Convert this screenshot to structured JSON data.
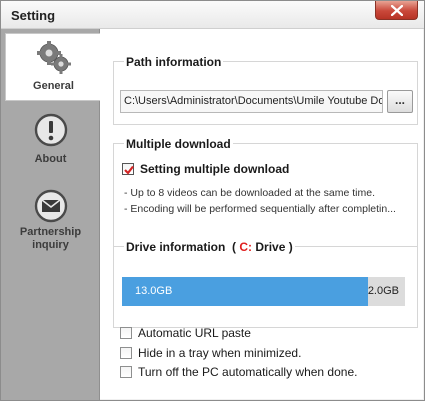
{
  "window": {
    "title": "Setting"
  },
  "sidebar": {
    "items": [
      {
        "label": "General",
        "icon": "gears-icon",
        "active": true
      },
      {
        "label": "About",
        "icon": "info-exclamation-icon",
        "active": false
      },
      {
        "label": "Partnership\ninquiry",
        "icon": "mail-icon",
        "active": false
      }
    ]
  },
  "path": {
    "title": "Path information",
    "value": "C:\\Users\\Administrator\\Documents\\Umile Youtube Do",
    "browse_label": "..."
  },
  "multiple": {
    "title": "Multiple download",
    "checkbox_label": "Setting multiple download",
    "checked": true,
    "notes": [
      "- Up to 8 videos can be downloaded at the same time.",
      "- Encoding will be performed sequentially after completin..."
    ]
  },
  "drive": {
    "title_prefix": "Drive information",
    "paren_open": "(",
    "drive_letter": "C:",
    "drive_word": "Drive",
    "paren_close": ")",
    "used_label": "13.0GB",
    "free_label": "2.0GB",
    "used_fraction": 0.87,
    "used_color": "#4a9fe0"
  },
  "options": [
    {
      "label": "Automatic URL paste",
      "checked": false
    },
    {
      "label": "Hide in a tray when minimized.",
      "checked": false
    },
    {
      "label": "Turn off the PC automatically when done.",
      "checked": false
    }
  ],
  "colors": {
    "accent": "#4a9fe0",
    "drive_letter": "#e02020",
    "sidebar_bg": "#a8a8a8",
    "close_button": "#c9483a"
  }
}
